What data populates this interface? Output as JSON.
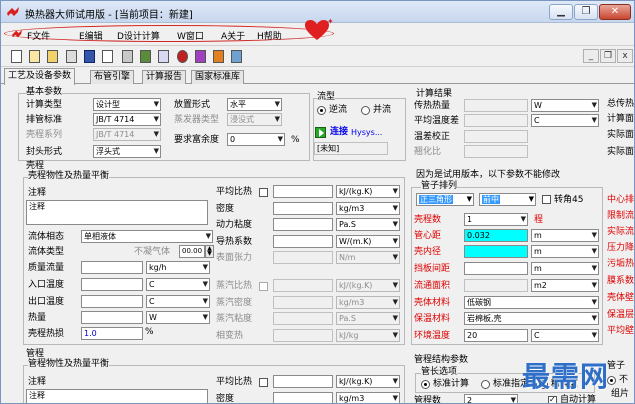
{
  "window": {
    "title": "换热器大师试用版 - [当前项目：新建]",
    "min_glyph": "▁",
    "restore_glyph": "❐",
    "close_glyph": "✕",
    "mdi_min": "_",
    "mdi_restore": "❐",
    "mdi_close": "x"
  },
  "menu": [
    "F文件",
    "E编辑",
    "D设计计算",
    "W窗口",
    "A关于",
    "H帮助"
  ],
  "tabs": [
    "工艺及设备参数",
    "布管引擎",
    "计算报告",
    "国家标准库"
  ],
  "basic": {
    "title": "基本参数",
    "calc_type_label": "计算类型",
    "calc_type": "设计型",
    "tube_std_label": "排管标准",
    "tube_std": "JB/T 4714",
    "shell_series_label": "壳程系列",
    "shell_series": "JB/T 4714",
    "head_label": "封头形式",
    "head": "浮头式",
    "place_label": "放置形式",
    "place": "水平",
    "evap_label": "蒸发器类型",
    "evap": "浸没式",
    "margin_label": "要求富余度",
    "margin": "0",
    "margin_unit": "%"
  },
  "flow": {
    "title": "流型",
    "counter": "逆流",
    "parallel": "并流",
    "connect": "连接",
    "hysys": "Hysys...",
    "unknown": "[未知]"
  },
  "result": {
    "title": "计算结果",
    "heat_label": "传热热量",
    "heat_unit": "W",
    "temp_label": "平均温度差",
    "temp_unit": "C",
    "corr_label": "温差校正",
    "ratio_label": "翘化比",
    "right1": "总传热",
    "right2": "计算面",
    "right3": "实际面",
    "right4": "实际面"
  },
  "shell": {
    "section": "壳程",
    "sub": "壳程物性及热量平衡",
    "note_label": "注释",
    "note_value": "注释",
    "phase_label": "流体相态",
    "phase": "单相液体",
    "ftype_label": "流体类型",
    "ftype_hint": "不凝气体",
    "ftype_num": "00.00",
    "mflow_label": "质量流量",
    "mflow_unit": "kg/h",
    "tin_label": "入口温度",
    "tin_unit": "C",
    "tout_label": "出口温度",
    "tout_unit": "C",
    "heat_label": "热量",
    "heat_unit": "W",
    "loss_label": "壳程热损",
    "loss": "1.0",
    "loss_unit": "%",
    "cp_label": "平均比热",
    "cp_unit": "kJ/(kg.K)",
    "rho_label": "密度",
    "rho_unit": "kg/m3",
    "mu_label": "动力粘度",
    "mu_unit": "Pa.S",
    "k_label": "导热系数",
    "k_unit": "W/(m.K)",
    "st_label": "表面张力",
    "st_unit": "N/m",
    "vcp_label": "蒸汽比热",
    "vcp_unit": "kJ/(kg.K)",
    "vrho_label": "蒸汽密度",
    "vrho_unit": "kg/m3",
    "vmu_label": "蒸汽粘度",
    "vmu_unit": "Pa.S",
    "latent_label": "相变热",
    "latent_unit": "kJ/kg"
  },
  "trial_note": "因为是试用版本，以下参数不能修改",
  "tube_arr": {
    "title": "管子排列",
    "layout": "正三角形",
    "pos": "前中",
    "rot_label": "转角45",
    "shellno_label": "壳程数",
    "shellno": "1",
    "shellno_suffix": "程",
    "od_label": "管心距",
    "od": "0.032",
    "id_label": "壳内径",
    "baffle_label": "挡板间距",
    "area_label": "流通面积",
    "mat_label": "壳体材料",
    "mat": "低碳钢",
    "ins_label": "保温材料",
    "ins": "岩棉板,壳",
    "amb_label": "环境温度",
    "amb": "20",
    "unit_m": "m",
    "unit_m2": "m2",
    "unit_c": "C",
    "right_labels": [
      "中心排",
      "限制流",
      "实际流",
      "压力降",
      "污垢热",
      "膜系数",
      "壳体壁",
      "保温层",
      "平均壁"
    ]
  },
  "tube": {
    "section": "管程",
    "sub": "管程物性及热量平衡",
    "note_label": "注释",
    "note_value": "注释",
    "cp_label": "平均比热",
    "cp_unit": "kJ/(kg.K)",
    "rho_label": "密度",
    "rho_unit": "kg/m3"
  },
  "tube_struct": {
    "title": "管程结构参数",
    "len_title": "管长选项",
    "std": "标准计算",
    "std2": "标准指定",
    "std3": "精确取",
    "count_label": "管程数",
    "count": "2",
    "auto": "自动计算",
    "right_top": "管子",
    "right_radio": "不",
    "right_bottom": "组片"
  },
  "watermark": "最需网",
  "colors": {
    "accent": "#e00000",
    "cyan": "#00ffff",
    "select_blue": "#3399ff"
  }
}
